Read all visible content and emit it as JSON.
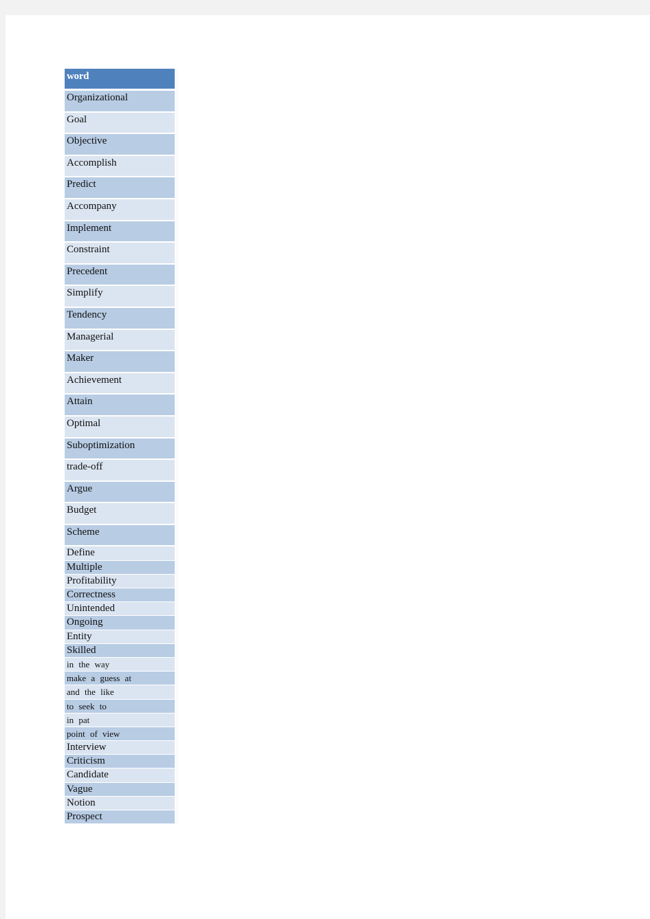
{
  "table": {
    "header": "word",
    "colors": {
      "header_bg": "#4f81bd",
      "band_dark": "#b8cce4",
      "band_light": "#dbe5f1"
    },
    "rows": [
      "Organizational",
      "Goal",
      "Objective",
      "Accomplish",
      "Predict",
      "Accompany",
      "Implement",
      "Constraint",
      "Precedent",
      "Simplify",
      "Tendency",
      "Managerial",
      "Maker",
      "Achievement",
      "Attain",
      "Optimal",
      "Suboptimization",
      "trade-off",
      "Argue",
      "Budget",
      "Scheme",
      "Define",
      "Multiple",
      "Profitability",
      "Correctness",
      "Unintended",
      "Ongoing",
      "Entity",
      "Skilled",
      "in the way",
      "make a guess at",
      "and the like",
      "to seek to",
      "in pat",
      "point of view",
      "Interview",
      "Criticism",
      "Candidate",
      "Vague",
      "Notion",
      "Prospect"
    ]
  }
}
